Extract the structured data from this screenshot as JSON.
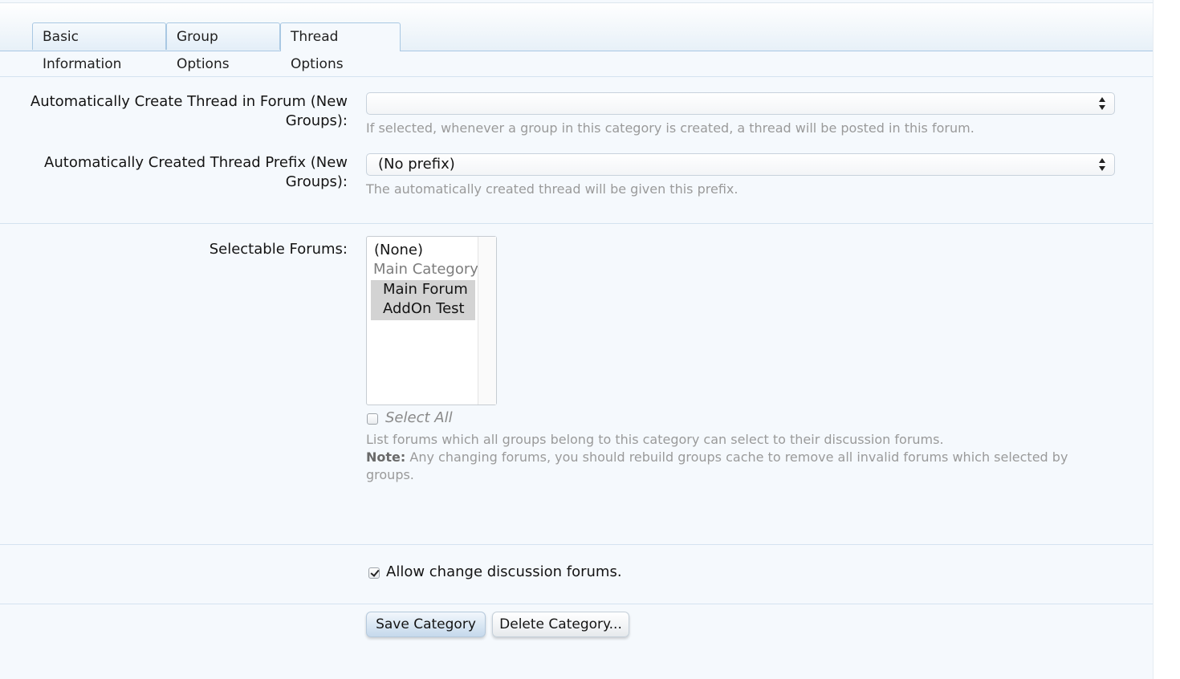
{
  "tabs": [
    {
      "label": "Basic Information",
      "active": false
    },
    {
      "label": "Group Options",
      "active": false
    },
    {
      "label": "Thread Options",
      "active": true
    }
  ],
  "auto_thread_forum": {
    "label": "Automatically Create Thread in Forum (New Groups):",
    "label_line1": "Automatically Create Thread in Forum (New",
    "label_line2": "Groups):",
    "value": "",
    "hint": "If selected, whenever a group in this category is created, a thread will be posted in this forum."
  },
  "auto_thread_prefix": {
    "label": "Automatically Created Thread Prefix (New Groups):",
    "label_line1": "Automatically Created Thread Prefix (New",
    "label_line2": "Groups):",
    "value": "(No prefix)",
    "hint": "The automatically created thread will be given this prefix."
  },
  "selectable_forums": {
    "label": "Selectable Forums:",
    "options": {
      "none": "(None)",
      "group": "Main Category",
      "item1": "Main Forum",
      "item2": "AddOn Test"
    },
    "select_all_label": "Select All",
    "select_all_checked": false,
    "hint": "List forums which all groups belong to this category can select to their discussion forums.",
    "note_label": "Note:",
    "note_line1": "Any changing forums, you should rebuild groups cache to remove all invalid forums which selected by",
    "note_line2": "groups."
  },
  "allow_change": {
    "label": "Allow change discussion forums.",
    "checked": true
  },
  "buttons": {
    "save": "Save Category",
    "delete": "Delete Category..."
  },
  "colors": {
    "tab_border": "#a9c8e3",
    "page_bg": "#f5f9fd",
    "hint_text": "#9a9a9a",
    "primary_button": "#d8e6f3"
  }
}
